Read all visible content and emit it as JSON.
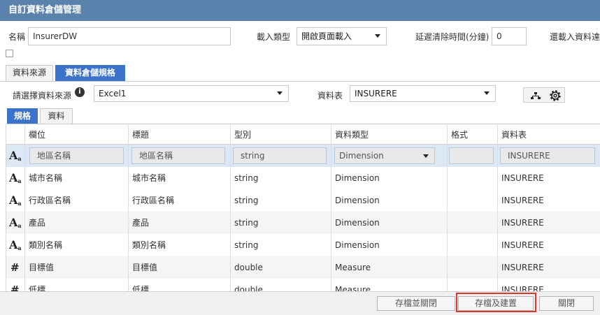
{
  "window": {
    "title": "自訂資料倉儲管理"
  },
  "form": {
    "name_label": "名稱",
    "name_value": "InsurerDW",
    "load_type_label": "載入類型",
    "load_type_value": "開啟頁面載入",
    "delay_clear_label": "延遲清除時間(分鐘)",
    "delay_clear_value": "0",
    "after_load_label": "還載入資料達"
  },
  "outer_tabs": [
    "資料來源",
    "資料倉儲規格"
  ],
  "source": {
    "select_label": "請選擇資料來源",
    "select_value": "Excel1",
    "table_label": "資料表",
    "table_value": "INSURERE"
  },
  "inner_tabs": [
    "規格",
    "資料"
  ],
  "grid": {
    "columns": [
      "欄位",
      "標題",
      "型別",
      "資料類型",
      "格式",
      "資料表"
    ],
    "filter": {
      "field": "地區名稱",
      "title": "地區名稱",
      "type": "string",
      "data_type": "Dimension",
      "format": "",
      "table": "INSURERE"
    },
    "rows": [
      {
        "icon": "text-field-icon",
        "field": "城市名稱",
        "title": "城市名稱",
        "type": "string",
        "data_type": "Dimension",
        "format": "",
        "table": "INSURERE"
      },
      {
        "icon": "text-field-icon",
        "field": "行政區名稱",
        "title": "行政區名稱",
        "type": "string",
        "data_type": "Dimension",
        "format": "",
        "table": "INSURERE"
      },
      {
        "icon": "text-field-icon",
        "field": "產品",
        "title": "產品",
        "type": "string",
        "data_type": "Dimension",
        "format": "",
        "table": "INSURERE"
      },
      {
        "icon": "text-field-icon",
        "field": "類別名稱",
        "title": "類別名稱",
        "type": "string",
        "data_type": "Dimension",
        "format": "",
        "table": "INSURERE"
      },
      {
        "icon": "numeric-field-icon",
        "field": "目標值",
        "title": "目標值",
        "type": "double",
        "data_type": "Measure",
        "format": "",
        "table": "INSURERE"
      },
      {
        "icon": "numeric-field-icon",
        "field": "低標",
        "title": "低標",
        "type": "double",
        "data_type": "Measure",
        "format": "",
        "table": "INSURERE"
      }
    ]
  },
  "footer": {
    "save_close": "存檔並關閉",
    "save_build": "存檔及建置",
    "close": "關閉"
  }
}
